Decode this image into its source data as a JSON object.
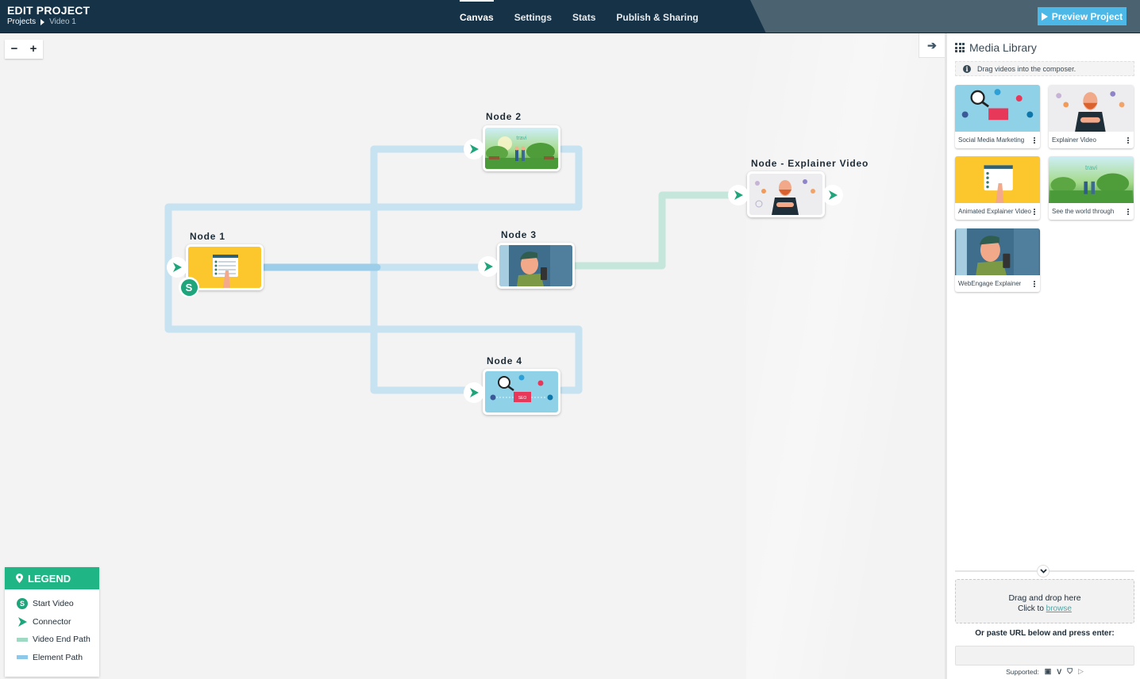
{
  "header": {
    "title": "EDIT PROJECT",
    "breadcrumb": [
      "Projects",
      "Video 1"
    ],
    "tabs": [
      {
        "label": "Canvas",
        "active": true
      },
      {
        "label": "Settings",
        "active": false
      },
      {
        "label": "Stats",
        "active": false
      },
      {
        "label": "Publish & Sharing",
        "active": false
      }
    ],
    "preview_button": "Preview Project"
  },
  "canvas": {
    "zoom_out_label": "−",
    "zoom_in_label": "+",
    "collapse_icon": "arrow-right-icon",
    "nodes": [
      {
        "id": "node1",
        "label": "Node 1",
        "start": true,
        "start_badge": "S",
        "thumbnail": "animated-explainer"
      },
      {
        "id": "node2",
        "label": "Node 2",
        "thumbnail": "travel-park"
      },
      {
        "id": "node3",
        "label": "Node 3",
        "thumbnail": "webengage-man"
      },
      {
        "id": "node4",
        "label": "Node 4",
        "thumbnail": "social-media-seo"
      },
      {
        "id": "node5",
        "label": "Node - Explainer Video",
        "thumbnail": "explainer-bearded-man"
      }
    ],
    "paths": [
      {
        "from": "Node 1",
        "to": "Node 2",
        "type": "element"
      },
      {
        "from": "Node 1",
        "to": "Node 3",
        "type": "element"
      },
      {
        "from": "Node 1",
        "to": "Node 4",
        "type": "element"
      },
      {
        "from": "Node 2",
        "to": "Node 1",
        "type": "element"
      },
      {
        "from": "Node 4",
        "to": "Node 1",
        "type": "element"
      },
      {
        "from": "Node 3",
        "to": "Node - Explainer Video",
        "type": "video-end"
      }
    ]
  },
  "legend": {
    "title": "LEGEND",
    "items": [
      {
        "label": "Start Video",
        "icon": "start-badge-icon"
      },
      {
        "label": "Connector",
        "icon": "connector-arrow-icon"
      },
      {
        "label": "Video End Path",
        "color": "#9fd9c4"
      },
      {
        "label": "Element Path",
        "color": "#8dc8e8"
      }
    ]
  },
  "colors": {
    "header_dark": "#163247",
    "header_light": "#4b6270",
    "accent_green": "#1fb584",
    "preview_blue": "#4bb8e8",
    "element_path": "#c7e2f0",
    "video_end_path": "#c5e6da"
  },
  "media_library": {
    "title": "Media Library",
    "hint": "Drag videos into the composer.",
    "items": [
      {
        "title": "Social Media Marketing",
        "thumbnail": "social-media-seo"
      },
      {
        "title": "Explainer Video",
        "thumbnail": "explainer-bearded-man"
      },
      {
        "title": "Animated Explainer Video",
        "thumbnail": "animated-explainer"
      },
      {
        "title": "See the world through",
        "thumbnail": "travel-park"
      },
      {
        "title": "WebEngage Explainer",
        "thumbnail": "webengage-man"
      }
    ],
    "dropzone_main": "Drag and drop here",
    "dropzone_sub_prefix": "Click to ",
    "dropzone_link": "browse",
    "paste_label": "Or paste URL below and press enter:",
    "url_value": "",
    "supported_label": "Supported:",
    "supported_icons": [
      "youtube-icon",
      "vimeo-icon",
      "html5-icon",
      "play-icon"
    ]
  }
}
